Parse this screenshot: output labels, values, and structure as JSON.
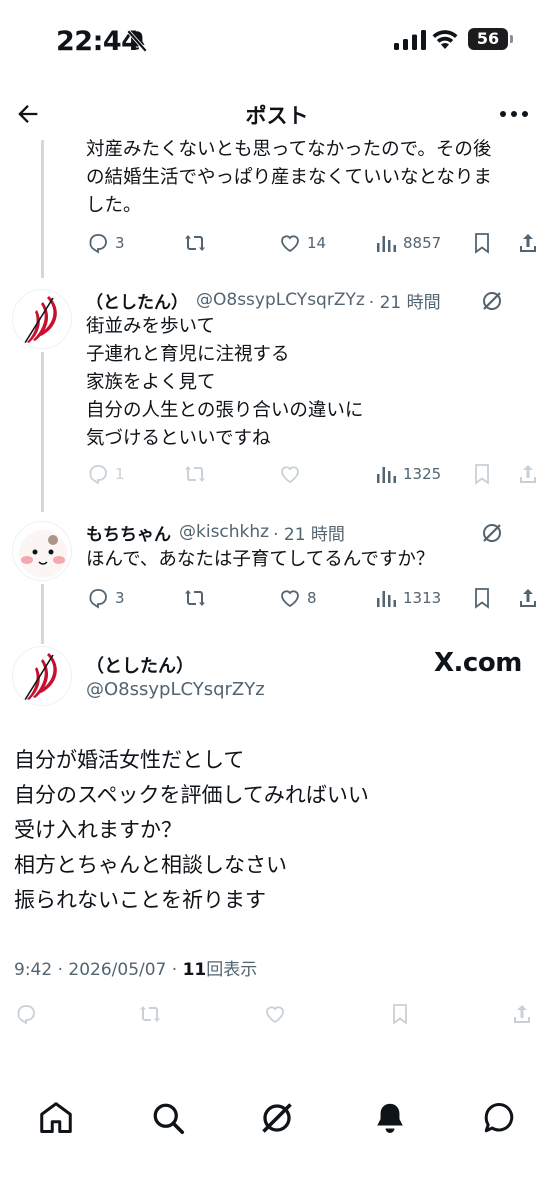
{
  "status_bar": {
    "time": "22:44",
    "battery": "56"
  },
  "header": {
    "title": "ポスト"
  },
  "top_tweet": {
    "text": "対産みたくないとも思ってなかったので。その後\nの結婚生活でやっぱり産まなくていいなとなりま\nした。",
    "replies": "3",
    "likes": "14",
    "views": "8857"
  },
  "reply1": {
    "name": "（としたん）",
    "handle": "@O8ssypLCYsqrZYz",
    "time": "· 21 時間",
    "text": "街並みを歩いて\n子連れと育児に注視する\n家族をよく見て\n自分の人生との張り合いの違いに\n気づけるといいですね",
    "replies": "1",
    "views": "1325"
  },
  "reply2": {
    "name": "もちちゃん",
    "handle": "@kischkhz",
    "time": "· 21 時間",
    "text": "ほんで、あなたは子育てしてるんですか？",
    "replies": "3",
    "likes": "8",
    "views": "1313"
  },
  "main_post": {
    "name": "（としたん）",
    "handle": "@O8ssypLCYsqrZYz",
    "watermark": "X.com",
    "text": "自分が婚活女性だとして\n自分のスペックを評価してみればいい\n受け入れますか？\n相方とちゃんと相談しなさい\n振られないことを祈ります",
    "time": "9:42 · 2026/05/07 · ",
    "views_count": "11",
    "views_label": "回表示"
  },
  "icons": {
    "reply": "reply-icon",
    "retweet": "retweet-icon",
    "like": "heart-icon",
    "views": "views-icon",
    "bookmark": "bookmark-icon",
    "share": "share-icon",
    "grok": "grok-icon"
  },
  "colors": {
    "text": "#0f1419",
    "secondary": "#536471",
    "line": "#cfd9de",
    "avatar_accent": "#c8102e"
  }
}
